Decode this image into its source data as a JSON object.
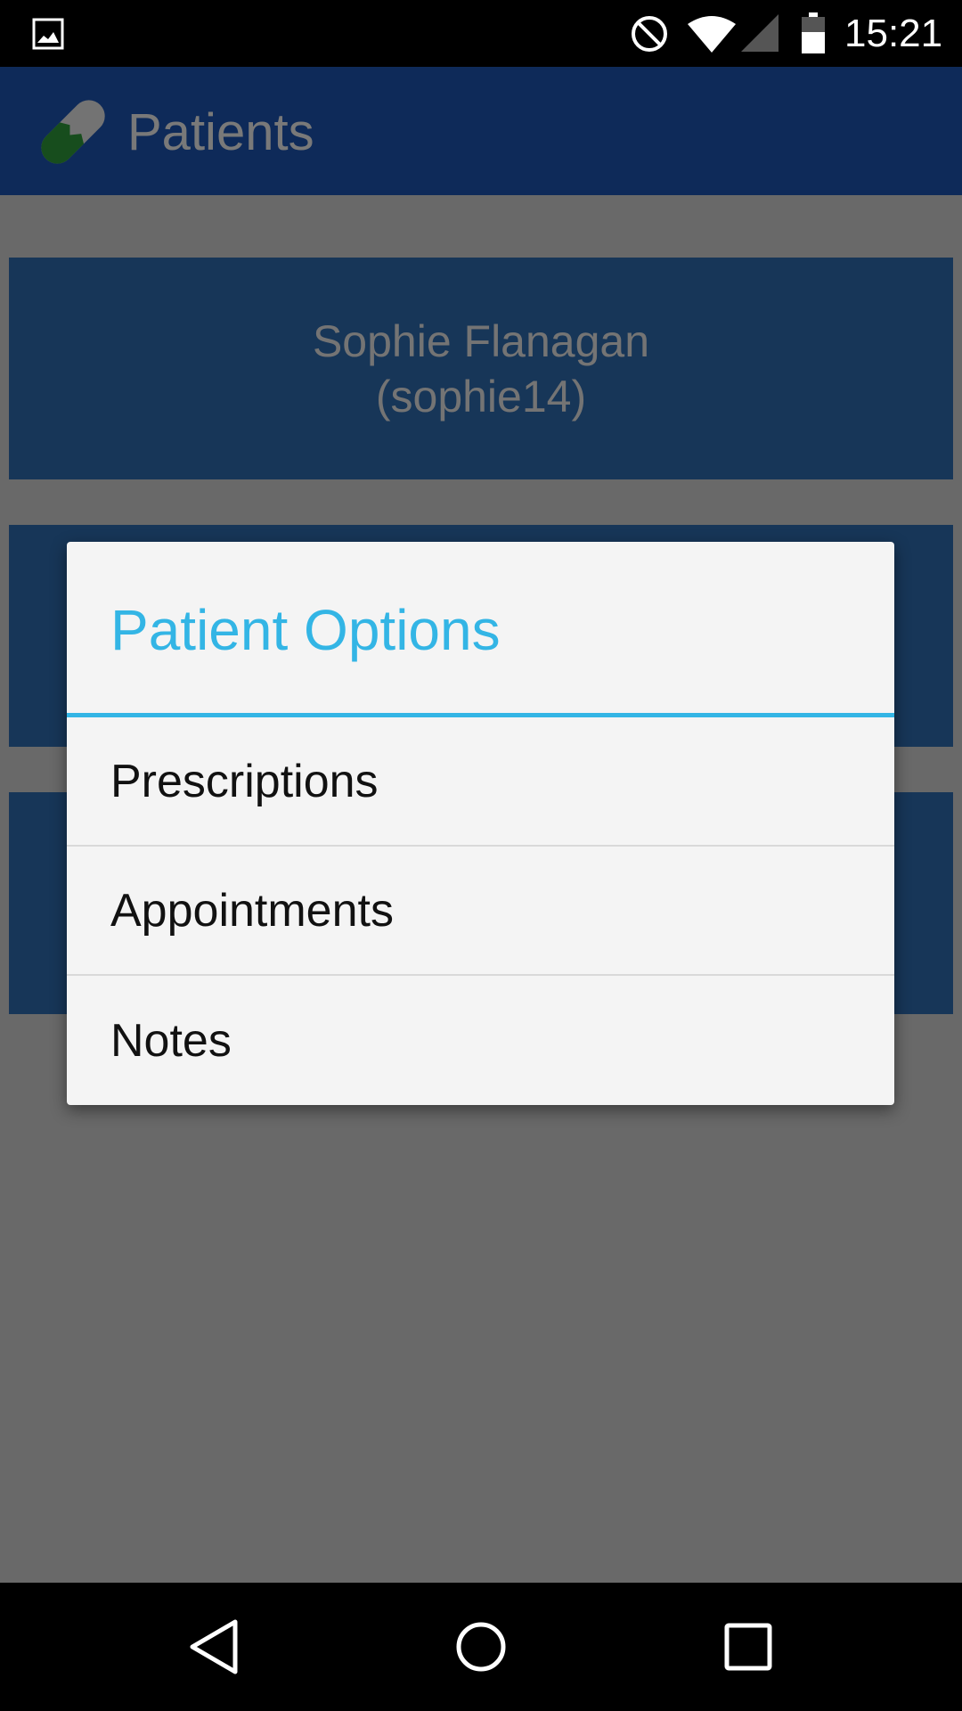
{
  "status_bar": {
    "time": "15:21",
    "icons": [
      "gallery-icon",
      "do-not-disturb-icon",
      "wifi-icon",
      "cell-signal-icon",
      "battery-icon"
    ]
  },
  "app_bar": {
    "title": "Patients",
    "logo": "pill-logo"
  },
  "patients": [
    {
      "name": "Sophie Flanagan",
      "username": "(sophie14)"
    },
    {
      "name": "",
      "username": ""
    },
    {
      "name": "",
      "username": ""
    }
  ],
  "dialog": {
    "title": "Patient Options",
    "items": [
      "Prescriptions",
      "Appointments",
      "Notes"
    ]
  },
  "nav_bar": {
    "icons": [
      "back-icon",
      "home-icon",
      "recents-icon"
    ]
  },
  "colors": {
    "app_bar": "#1d55b2",
    "card": "#2e6cb0",
    "dialog_accent": "#33b5e5",
    "scrim": "rgba(0,0,0,0.5)"
  }
}
